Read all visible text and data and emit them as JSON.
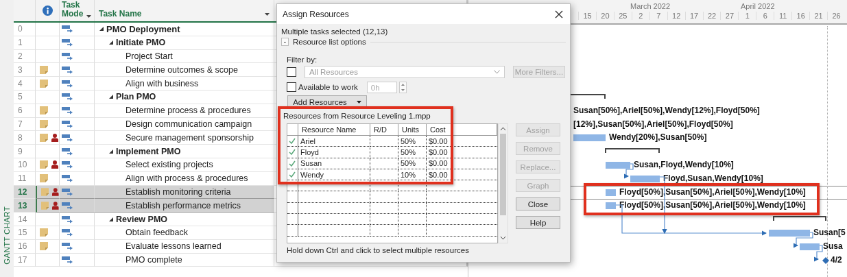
{
  "side_label": "GANTT CHART",
  "columns": [
    "Task Mode",
    "Task Name"
  ],
  "tasks": [
    {
      "id": "0",
      "name": "PMO Deployment",
      "note": false,
      "resource": false,
      "selected": false,
      "expanded": true,
      "children": [
        {
          "id": "1",
          "name": "Initiate PMO",
          "note": false,
          "resource": false,
          "selected": false,
          "expanded": true,
          "children": [
            {
              "id": "2",
              "name": "Project Start",
              "note": false,
              "resource": false,
              "selected": false
            },
            {
              "id": "3",
              "name": "Determine outcomes & scope",
              "note": true,
              "resource": false,
              "selected": false
            },
            {
              "id": "4",
              "name": "Align with business",
              "note": true,
              "resource": false,
              "selected": false
            }
          ]
        },
        {
          "id": "5",
          "name": "Plan PMO",
          "note": false,
          "resource": false,
          "selected": false,
          "expanded": true,
          "children": [
            {
              "id": "6",
              "name": "Determine process & procedures",
              "note": true,
              "resource": false,
              "selected": false
            },
            {
              "id": "7",
              "name": "Design communication campaign",
              "note": true,
              "resource": false,
              "selected": false
            },
            {
              "id": "8",
              "name": "Secure management sponsorship",
              "note": true,
              "resource": true,
              "selected": false
            }
          ]
        },
        {
          "id": "9",
          "name": "Implement PMO",
          "note": false,
          "resource": false,
          "selected": false,
          "expanded": true,
          "children": [
            {
              "id": "10",
              "name": "Select existing projects",
              "note": true,
              "resource": true,
              "selected": false
            },
            {
              "id": "11",
              "name": "Align with process & procedures",
              "note": true,
              "resource": false,
              "selected": false
            },
            {
              "id": "12",
              "name": "Establish monitoring criteria",
              "note": true,
              "resource": true,
              "selected": true
            },
            {
              "id": "13",
              "name": "Establish performance metrics",
              "note": true,
              "resource": true,
              "selected": true
            }
          ]
        },
        {
          "id": "14",
          "name": "Review PMO",
          "note": false,
          "resource": false,
          "selected": false,
          "expanded": true,
          "children": [
            {
              "id": "15",
              "name": "Obtain feedback",
              "note": true,
              "resource": false,
              "selected": false
            },
            {
              "id": "16",
              "name": "Evaluate lessons learned",
              "note": true,
              "resource": false,
              "selected": false
            },
            {
              "id": "17",
              "name": "PMO complete",
              "note": false,
              "resource": false,
              "selected": false
            }
          ]
        }
      ]
    }
  ],
  "gantt": {
    "months": [
      "March 2022",
      "April 2022"
    ],
    "days": [
      "15",
      "20",
      "25",
      "2",
      "7",
      "12",
      "17",
      "22",
      "27",
      "1",
      "6",
      "11",
      "16",
      "21",
      "26"
    ],
    "bars": [
      {
        "kind": "summary"
      },
      {
        "kind": "label",
        "label": "Susan[50%],Ariel[50%],Wendy[12%],Floyd[50%]"
      },
      {
        "kind": "label",
        "label": "[12%],Susan[50%],Ariel[50%],Floyd[50%]"
      },
      {
        "kind": "bar",
        "label": "Wendy[20%],Susan[50%]"
      },
      {
        "kind": "summary"
      },
      {
        "kind": "bar",
        "label": "Susan,Floyd,Wendy[10%]"
      },
      {
        "kind": "bar",
        "label": "Floyd,Susan,Wendy[10%]"
      },
      {
        "kind": "bar",
        "label": "Floyd[50%],Susan[50%],Ariel[50%],Wendy[10%]"
      },
      {
        "kind": "bar",
        "label": "Floyd[50%],Susan[50%],Ariel[50%],Wendy[10%]"
      },
      {
        "kind": "summary"
      },
      {
        "kind": "bar",
        "label": "Susan[5"
      },
      {
        "kind": "bar",
        "label": "Susa"
      },
      {
        "kind": "milestone",
        "label": "4/2"
      }
    ]
  },
  "dialog": {
    "title": "Assign Resources",
    "subtitle": "Multiple tasks selected (12,13)",
    "toggle": {
      "symbol": "-",
      "label": "Resource list options"
    },
    "filter": {
      "label": "Filter by:",
      "checked": false,
      "value": "All Resources",
      "disabled": true,
      "button": {
        "label": "More Filters...",
        "disabled": true
      }
    },
    "available": {
      "label": "Available to work",
      "checked": false,
      "value": "0h",
      "disabled": true
    },
    "add_button": "Add Resources",
    "list_title": "Resources from Resource Leveling 1.mpp",
    "columns": [
      "Resource Name",
      "R/D",
      "Units",
      "Cost"
    ],
    "resources": [
      {
        "assigned": true,
        "name": "Ariel",
        "units": "50%",
        "cost": "$0.00"
      },
      {
        "assigned": true,
        "name": "Floyd",
        "units": "50%",
        "cost": "$0.00"
      },
      {
        "assigned": true,
        "name": "Susan",
        "units": "50%",
        "cost": "$0.00"
      },
      {
        "assigned": true,
        "name": "Wendy",
        "units": "10%",
        "cost": "$0.00"
      }
    ],
    "buttons": [
      {
        "label": "Assign",
        "disabled": true
      },
      {
        "label": "Remove",
        "disabled": true
      },
      {
        "label": "Replace...",
        "disabled": true
      },
      {
        "label": "Graph",
        "disabled": true
      },
      {
        "label": "Close",
        "disabled": false
      },
      {
        "label": "Help",
        "disabled": false
      }
    ],
    "hint": "Hold down Ctrl and click to select multiple resources"
  }
}
